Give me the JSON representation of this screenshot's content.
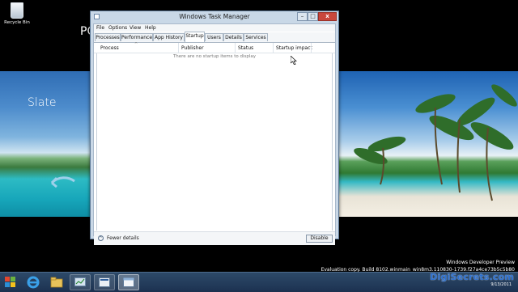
{
  "desktop": {
    "recycle_bin_label": "Recycle Bin",
    "slate_text": "Slate",
    "slate_text_cut": "PC",
    "watermark_line1": "Windows Developer Preview",
    "watermark_line2": "Evaluation copy. Build 8102.winmain_win8m3.110830-1739.f27a4ce73b5c5b80",
    "brand": "DigiSecrets.com",
    "date": "9/13/2011"
  },
  "window": {
    "title": "Windows Task Manager",
    "controls": {
      "minimize": "–",
      "maximize": "□",
      "close": "x"
    },
    "menu": [
      "File",
      "Options",
      "View",
      "Help"
    ],
    "tabs": [
      "Processes",
      "Performance",
      "App History",
      "Startup",
      "Users",
      "Details",
      "Services"
    ],
    "active_tab": "Startup",
    "columns": [
      "Process",
      "Publisher",
      "Status",
      "Startup impact"
    ],
    "empty_message": "There are no startup items to display",
    "fewer_details": "Fewer details",
    "disable_button": "Disable"
  },
  "colors": {
    "window_frame": "#c9d8e7",
    "taskbar": "#1c3150",
    "close_button": "#c8473c",
    "brand_blue": "#2b6fcf"
  },
  "taskbar": {
    "icons": [
      "start-icon",
      "internet-explorer-icon",
      "file-explorer-icon",
      "task-manager-icon",
      "app-icon",
      "window-icon"
    ]
  }
}
